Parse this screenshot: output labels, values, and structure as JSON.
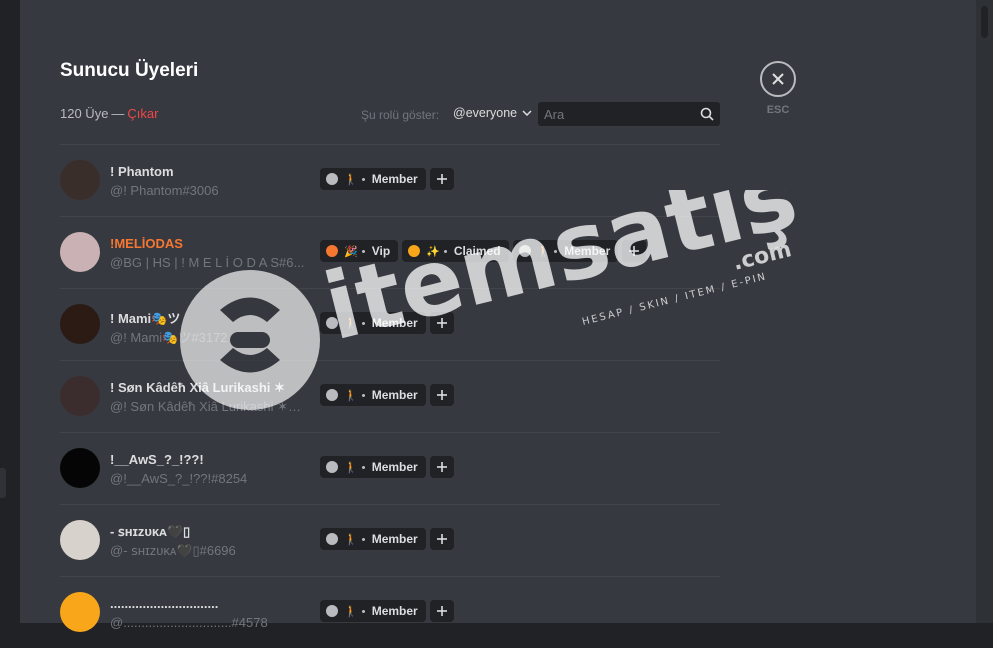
{
  "modal": {
    "title": "Sunucu Üyeleri",
    "member_count": "120 Üye",
    "separator": "—",
    "prune_label": "Çıkar",
    "role_filter_label": "Şu rolü göster:",
    "role_filter_value": "@everyone",
    "search_placeholder": "Ara",
    "esc_label": "ESC"
  },
  "members": [
    {
      "name": "! Phantom",
      "tag": "@! Phantom#3006",
      "name_color": "#dcddde",
      "avatar_color": "#3a2e2a",
      "roles": [
        {
          "label": "Member",
          "dot_color": "#b9bbbe",
          "emoji": "🚶"
        }
      ]
    },
    {
      "name": "!MELİODAS",
      "tag": "@BG | HS | ! M E L İ O D A S#6...",
      "name_color": "#f57731",
      "avatar_color": "#c9b1b4",
      "roles": [
        {
          "label": "Vip",
          "dot_color": "#f57731",
          "emoji": "🎉"
        },
        {
          "label": "Claimed",
          "dot_color": "#faa61a",
          "emoji": "✨"
        },
        {
          "label": "Member",
          "dot_color": "#b9bbbe",
          "emoji": "🚶"
        }
      ]
    },
    {
      "name": "! Mami🎭ツ",
      "tag": "@! Mami🎭ツ#3172",
      "name_color": "#dcddde",
      "avatar_color": "#2b1b14",
      "roles": [
        {
          "label": "Member",
          "dot_color": "#b9bbbe",
          "emoji": "🚶"
        }
      ]
    },
    {
      "name": "! Søn Kâdêħ Xiâ Lurikashi ✶",
      "tag": "@! Søn Kâdêħ Xiâ Lurikashi ✶#...",
      "name_color": "#dcddde",
      "avatar_color": "#3b2d2d",
      "roles": [
        {
          "label": "Member",
          "dot_color": "#b9bbbe",
          "emoji": "🚶"
        }
      ]
    },
    {
      "name": "!__AwS_?_!??!",
      "tag": "@!__AwS_?_!??!#8254",
      "name_color": "#dcddde",
      "avatar_color": "#050505",
      "roles": [
        {
          "label": "Member",
          "dot_color": "#b9bbbe",
          "emoji": "🚶"
        }
      ]
    },
    {
      "name": "- ꜱʜɪᴢᴜᴋᴀ🖤▯",
      "tag": "@- ꜱʜɪᴢᴜᴋᴀ🖤▯#6696",
      "name_color": "#dcddde",
      "avatar_color": "#d8d2cc",
      "roles": [
        {
          "label": "Member",
          "dot_color": "#b9bbbe",
          "emoji": "🚶"
        }
      ]
    },
    {
      "name": "..............................",
      "tag": "@..............................#4578",
      "name_color": "#dcddde",
      "avatar_color": "#faa61a",
      "roles": [
        {
          "label": "Member",
          "dot_color": "#b9bbbe",
          "emoji": "🚶"
        }
      ]
    }
  ],
  "watermark": {
    "brand": "itemsatış",
    "domain": ".com",
    "tagline": "HESAP / SKIN / ITEM / E-PIN"
  },
  "colors": {
    "background": "#36393f",
    "danger": "#f04747",
    "text_primary": "#dcddde",
    "text_muted": "#72767d",
    "pill_bg": "#202225"
  }
}
